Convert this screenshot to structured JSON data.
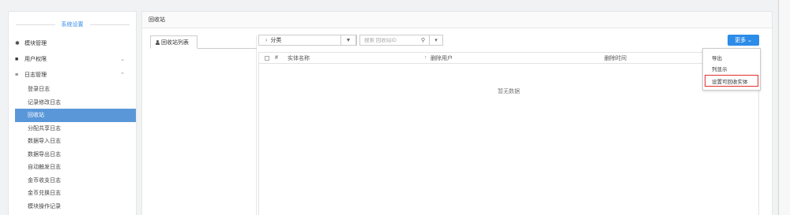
{
  "sidebar": {
    "title": "系统设置",
    "groups": [
      {
        "icon": "gear-icon",
        "label": "模块管理"
      },
      {
        "icon": "lock-icon",
        "label": "用户权限"
      },
      {
        "icon": "list-icon",
        "label": "日志管理"
      }
    ],
    "log_items": [
      "登录日志",
      "记录修改日志",
      "回收站",
      "分配共享日志",
      "数据导入日志",
      "数据导出日志",
      "自动触发日志",
      "金币收支日志",
      "金币兑换日志",
      "模块操作记录"
    ],
    "active_item": "回收站"
  },
  "main": {
    "title": "回收站",
    "tab_label": "回收站列表",
    "filter": {
      "label": "分类"
    },
    "search": {
      "placeholder": "搜索 回收站ID"
    },
    "more_button": "更多",
    "table": {
      "columns": [
        "#",
        "实体名称",
        "删除用户",
        "删除时间"
      ],
      "empty_text": "暂无数据"
    },
    "dropdown": {
      "items": [
        "导出",
        "列显示",
        "设置可回收实体"
      ],
      "highlighted": "设置可回收实体",
      "highlight_color": "#e03030"
    }
  },
  "colors": {
    "accent": "#2d8ce8",
    "active_bg": "#5a97d9",
    "title_blue": "#3a8ee6"
  }
}
